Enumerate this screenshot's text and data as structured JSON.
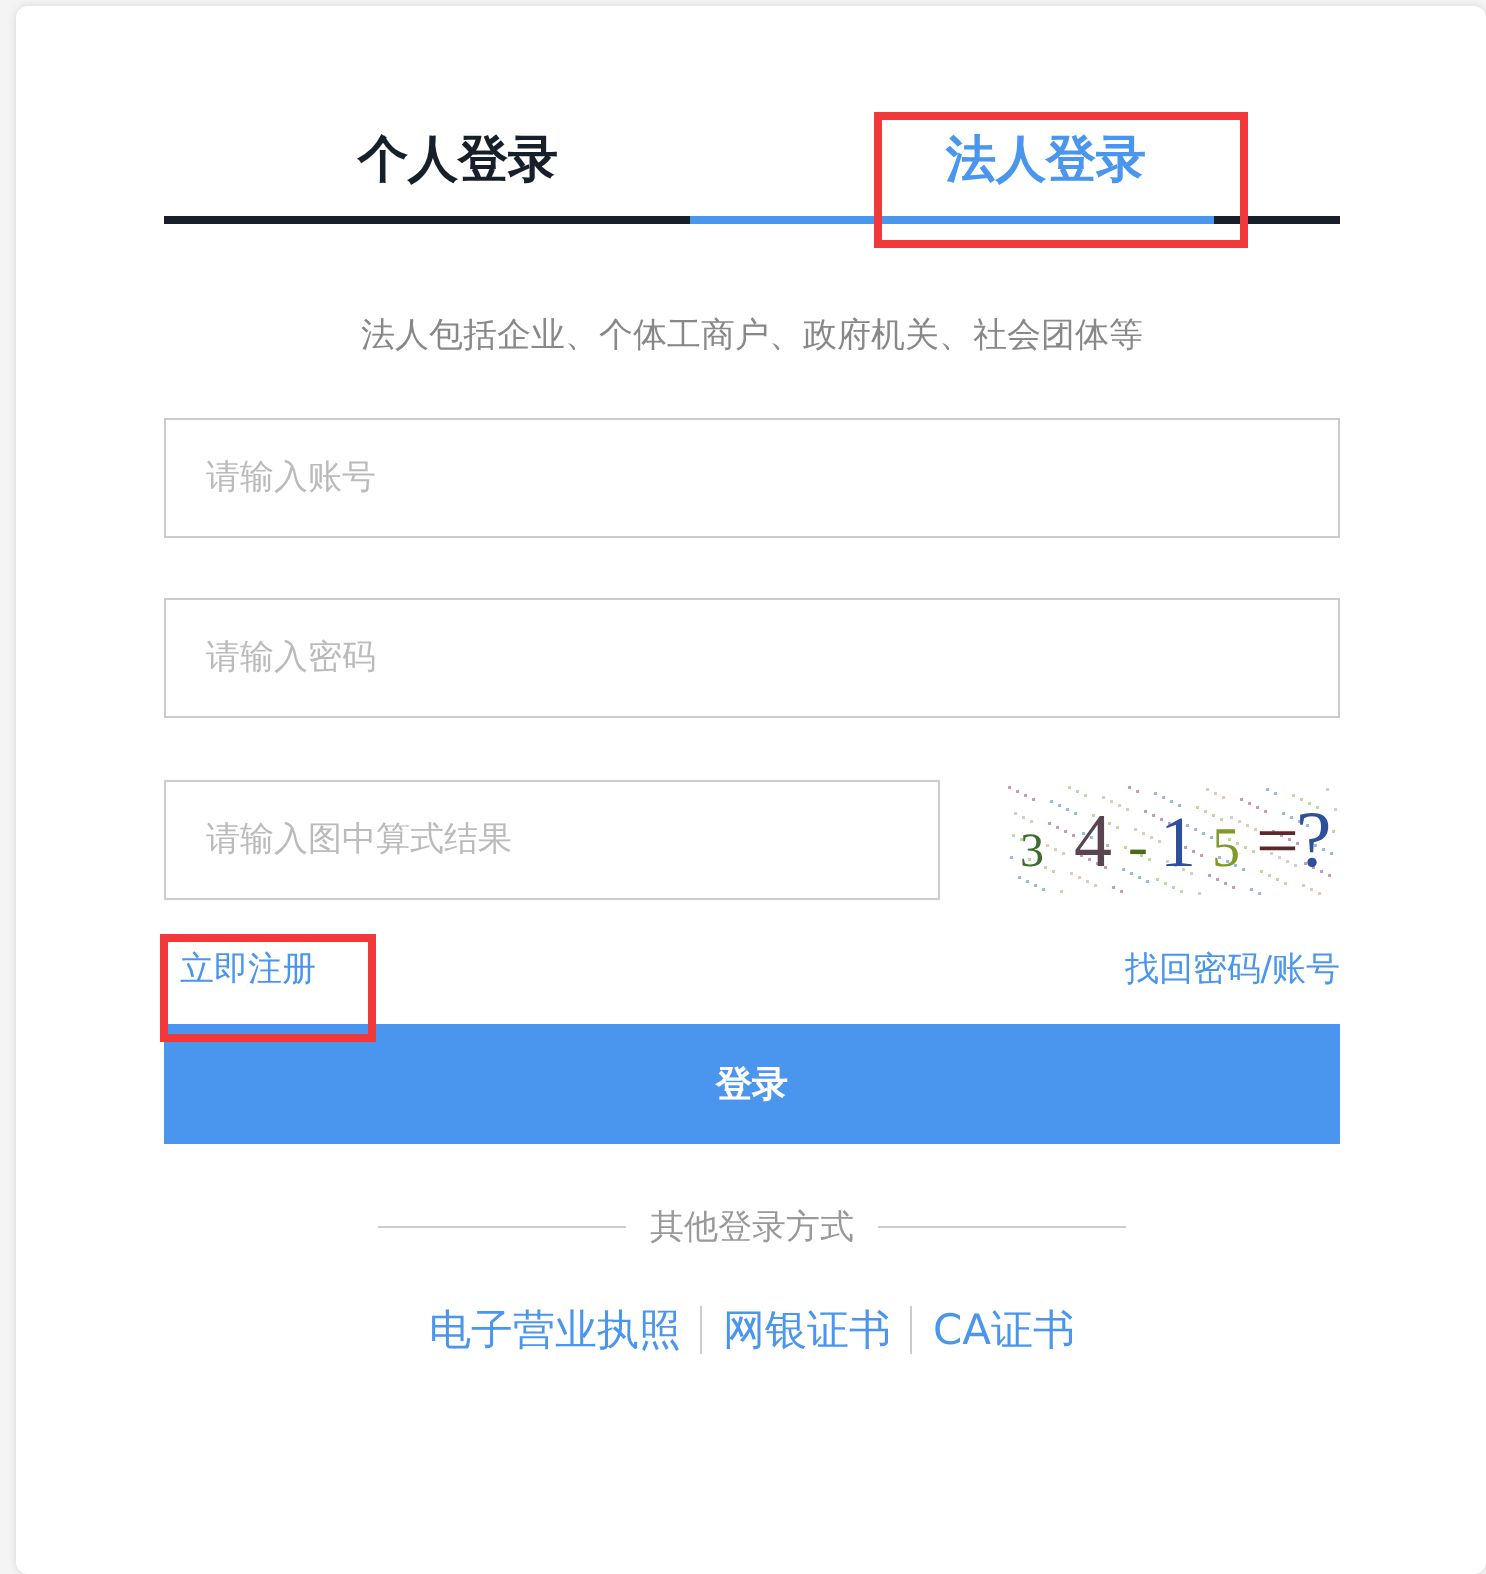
{
  "tabs": [
    {
      "label": "个人登录",
      "selected": false,
      "highlighted": false
    },
    {
      "label": "法人登录",
      "selected": true,
      "highlighted": true
    }
  ],
  "hint": "法人包括企业、个体工商户、政府机关、社会团体等",
  "fields": [
    {
      "placeholder": "请输入账号"
    },
    {
      "placeholder": "请输入密码"
    }
  ],
  "captcha_field": {
    "placeholder": "请输入图中算式结果"
  },
  "captcha": {
    "characters": [
      {
        "char": "3",
        "color": "#3f6b2e"
      },
      {
        "char": "4",
        "color": "#5a4450"
      },
      {
        "char": "-",
        "color": "#4c6b1a"
      },
      {
        "char": "1",
        "color": "#2f4f9a"
      },
      {
        "char": "5",
        "color": "#7e9a28"
      },
      {
        "char": "=",
        "color": "#5a2a2a"
      },
      {
        "char": "?",
        "color": "#2f4f9a"
      }
    ]
  },
  "register_link": {
    "label": "立即注册",
    "highlighted": true
  },
  "recover_link": {
    "label": "找回密码/账号"
  },
  "login_button": "登录",
  "other_methods": {
    "title": "其他登录方式",
    "links": [
      "电子营业执照",
      "网银证书",
      "CA证书"
    ]
  }
}
